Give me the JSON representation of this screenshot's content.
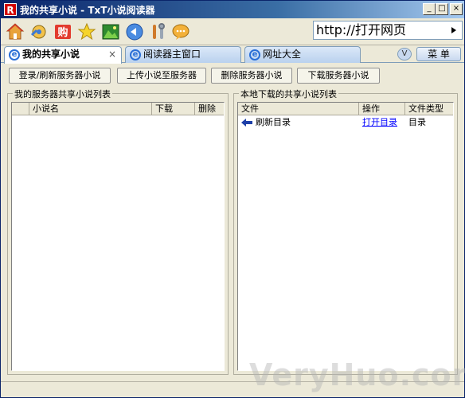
{
  "window": {
    "title": "我的共享小说 - TxT小说阅读器",
    "app_icon_letter": "R",
    "min_symbol": "_",
    "max_symbol": "□",
    "close_symbol": "×"
  },
  "toolbar": {
    "icons": [
      "home-icon",
      "settings-gear-icon",
      "shop-buy-icon",
      "star-favorite-icon",
      "landscape-image-icon",
      "back-arrow-icon",
      "tools-icon",
      "chat-bubble-icon"
    ],
    "url_placeholder": "http://打开网页"
  },
  "tabs": [
    {
      "label": "我的共享小说",
      "active": true,
      "close": "×"
    },
    {
      "label": "阅读器主窗口",
      "active": false
    },
    {
      "label": "网址大全",
      "active": false
    }
  ],
  "tab_more": "V",
  "menu_label": "菜 单",
  "actions": {
    "login_refresh": "登录/刷新服务器小说",
    "upload": "上传小说至服务器",
    "delete": "删除服务器小说",
    "download": "下载服务器小说"
  },
  "server_panel": {
    "title": "我的服务器共享小说列表",
    "columns": [
      "",
      "小说名",
      "下载",
      "删除"
    ]
  },
  "local_panel": {
    "title": "本地下载的共享小说列表",
    "columns": [
      "文件",
      "操作",
      "文件类型"
    ],
    "rows": [
      {
        "name": "刷新目录",
        "action": "打开目录",
        "type": "目录"
      }
    ]
  },
  "watermark": "VeryHuo.com"
}
